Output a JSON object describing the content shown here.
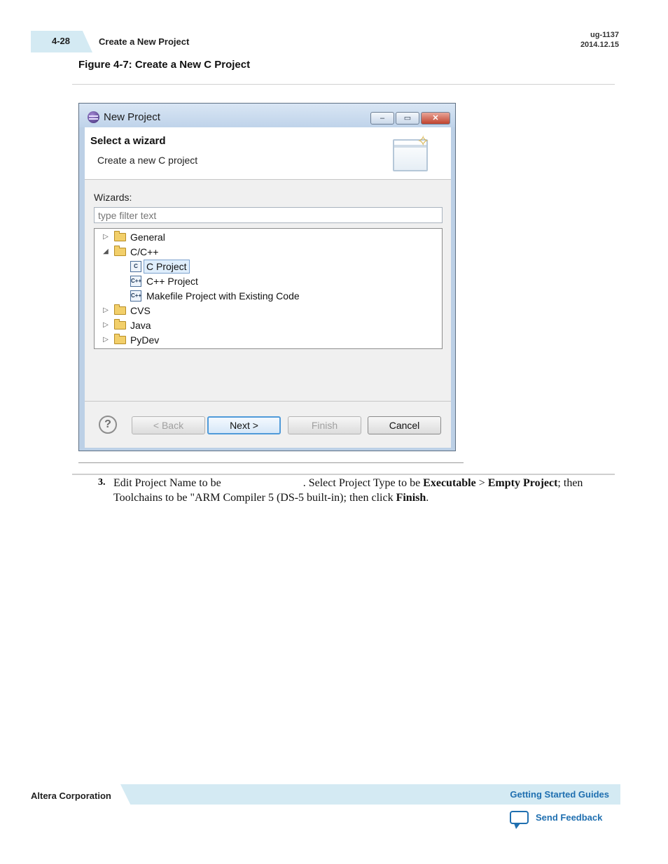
{
  "header": {
    "page_number": "4-28",
    "section_title": "Create a New Project",
    "doc_id": "ug-1137",
    "doc_date": "2014.12.15"
  },
  "figure": {
    "caption": "Figure 4-7: Create a New C Project"
  },
  "dialog": {
    "title": "New Project",
    "window_buttons": [
      "–",
      "▭",
      "✕"
    ],
    "banner_title": "Select a wizard",
    "banner_description": "Create a new C project",
    "wizards_label": "Wizards:",
    "filter_placeholder": "type filter text",
    "tree": [
      {
        "label": "General",
        "expanded": false
      },
      {
        "label": "C/C++",
        "expanded": true
      },
      {
        "label": "C Project",
        "selected": true,
        "icon": "C"
      },
      {
        "label": "C++ Project",
        "icon": "C++"
      },
      {
        "label": "Makefile Project with Existing Code",
        "icon": "C++"
      },
      {
        "label": "CVS",
        "expanded": false
      },
      {
        "label": "Java",
        "expanded": false
      },
      {
        "label": "PyDev",
        "expanded": false
      }
    ],
    "buttons": {
      "back": "< Back",
      "next": "Next >",
      "finish": "Finish",
      "cancel": "Cancel"
    },
    "help_symbol": "?"
  },
  "step": {
    "number": "3.",
    "text_1": "Edit Project Name to be",
    "text_2": ". Select Project Type to be",
    "executable": "Executable",
    "sep": ">",
    "empty_project": "Empty Project",
    "text_3": "; then Toolchains to be \"ARM Compiler 5 (DS-5 built-in); then click",
    "finish": "Finish",
    "period": "."
  },
  "footer": {
    "company": "Altera Corporation",
    "guides_link": "Getting Started Guides",
    "feedback_link": "Send Feedback"
  },
  "colors": {
    "band": "#d4eaf3",
    "link": "#1f6fb0"
  }
}
